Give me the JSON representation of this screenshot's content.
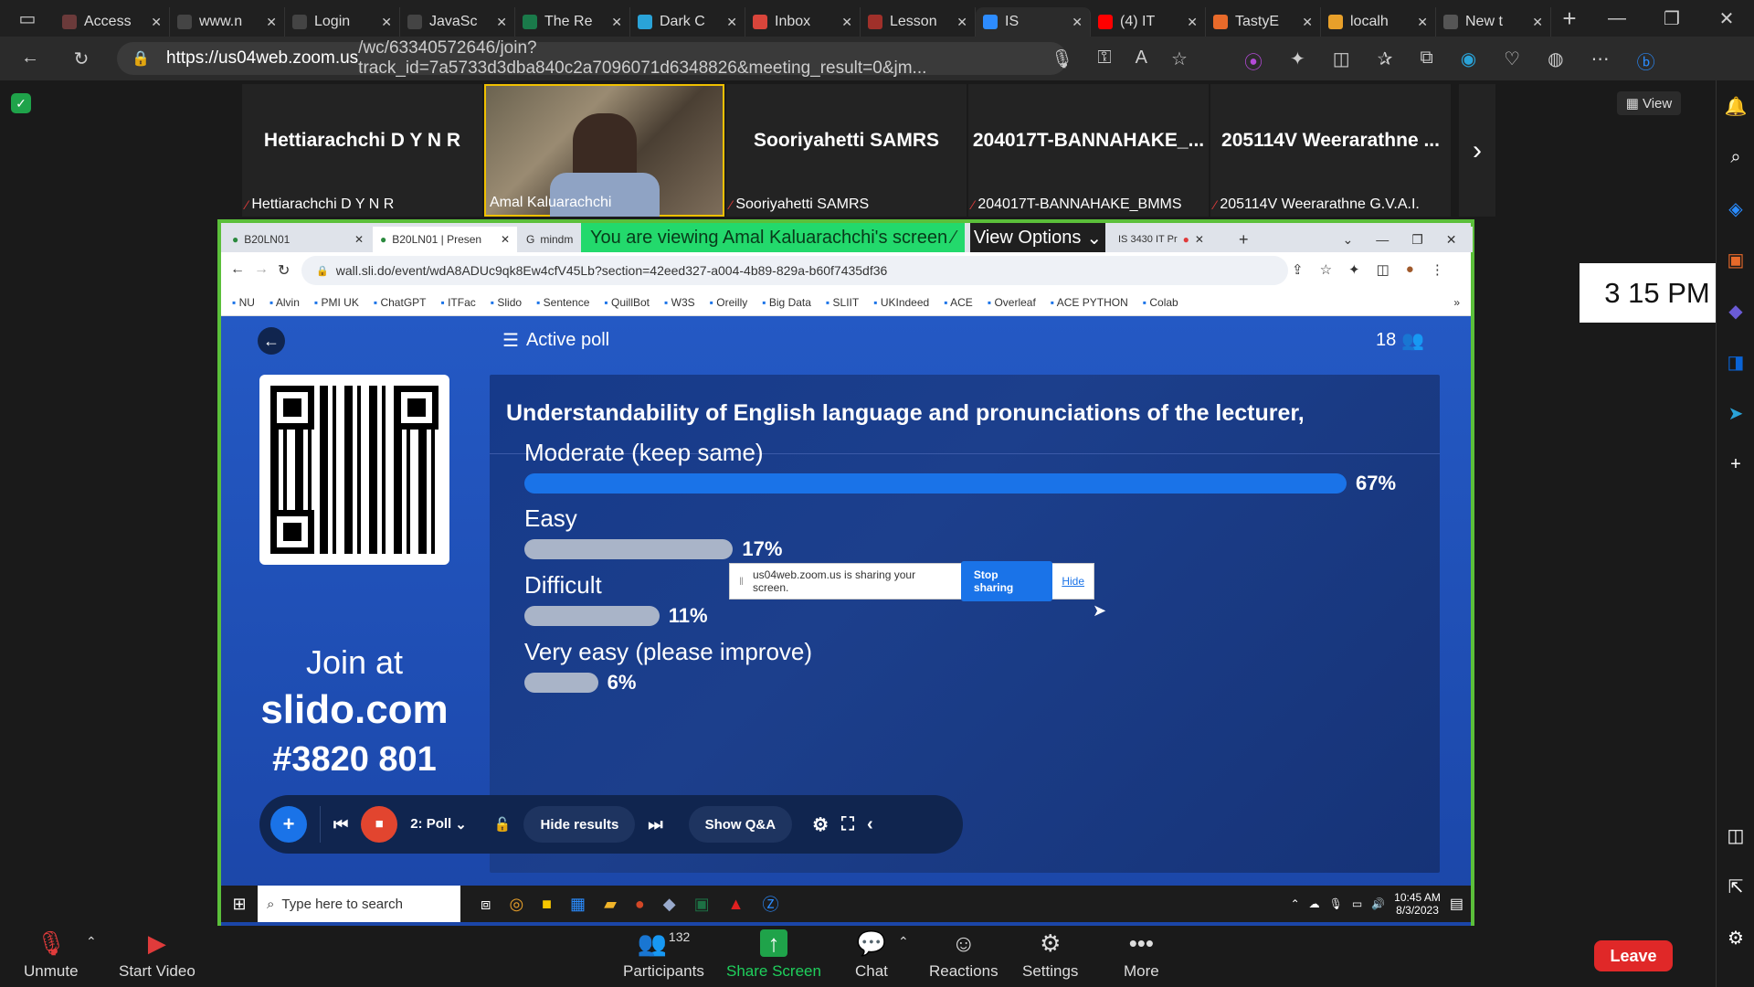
{
  "browser": {
    "tabs": [
      {
        "title": "Access",
        "color": "#6b3a3a"
      },
      {
        "title": "www.n",
        "color": "#444"
      },
      {
        "title": "Login",
        "color": "#444"
      },
      {
        "title": "JavaSc",
        "color": "#444"
      },
      {
        "title": "The Re",
        "color": "#1a7a4a"
      },
      {
        "title": "Dark C",
        "color": "#2aa3d8"
      },
      {
        "title": "Inbox",
        "color": "#d9453b"
      },
      {
        "title": "Lesson",
        "color": "#a0302a"
      },
      {
        "title": "IS",
        "color": "#2d8cff"
      },
      {
        "title": "(4) IT",
        "color": "#ff0000"
      },
      {
        "title": "TastyE",
        "color": "#e86a2a"
      },
      {
        "title": "localh",
        "color": "#e8a02a"
      },
      {
        "title": "New t",
        "color": "#555"
      }
    ],
    "url_host": "https://us04web.zoom.us",
    "url_path": "/wc/63340572646/join?track_id=7a5733d3dba840c2a7096071d6348826&meeting_result=0&jm..."
  },
  "participants": [
    {
      "name": "Hettiarachchi D Y N R",
      "label": "Hettiarachchi D Y N R",
      "video": false,
      "muted": true
    },
    {
      "name": "",
      "label": "Amal Kaluarachchi",
      "video": true,
      "muted": false
    },
    {
      "name": "Sooriyahetti SAMRS",
      "label": "Sooriyahetti SAMRS",
      "video": false,
      "muted": true
    },
    {
      "name": "204017T-BANNAHAKE_...",
      "label": "204017T-BANNAHAKE_BMMS",
      "video": false,
      "muted": true
    },
    {
      "name": "205114V Weerarathne ...",
      "label": "205114V Weerarathne G.V.A.I.",
      "video": false,
      "muted": true
    }
  ],
  "view_button": "View",
  "clock_text": "3 15 PM",
  "share": {
    "banner": "You are viewing Amal Kaluarachchi's screen",
    "view_options": "View Options",
    "chrome_tabs": [
      "B20LN01",
      "B20LN01 | Presen",
      "mindm",
      "IS 3430 IT Pr"
    ],
    "chrome_url": "wall.sli.do/event/wdA8ADUc9qk8Ew4cfV45Lb?section=42eed327-a004-4b89-829a-b60f7435df36",
    "bookmarks": [
      "NU",
      "Alvin",
      "PMI UK",
      "ChatGPT",
      "ITFac",
      "Slido",
      "Sentence",
      "QuillBot",
      "W3S",
      "Oreilly",
      "Big Data",
      "SLIIT",
      "UKIndeed",
      "ACE",
      "Overleaf",
      "ACE PYTHON",
      "Colab"
    ],
    "notice_text": "us04web.zoom.us is sharing your screen.",
    "notice_stop": "Stop sharing",
    "notice_hide": "Hide"
  },
  "slido": {
    "header": "Active poll",
    "participant_count": "18",
    "join_at": "Join at",
    "site": "slido.com",
    "code": "#3820 801",
    "question": "Understandability of English language and pronunciations of the lecturer,",
    "options": [
      {
        "label": "Moderate (keep same)",
        "percent": 67,
        "percent_text": "67%",
        "color": "#1a73e8"
      },
      {
        "label": "Easy",
        "percent": 17,
        "percent_text": "17%",
        "color": "#a9b4c8"
      },
      {
        "label": "Difficult",
        "percent": 11,
        "percent_text": "11%",
        "color": "#a9b4c8"
      },
      {
        "label": "Very easy (please improve)",
        "percent": 6,
        "percent_text": "6%",
        "color": "#a9b4c8"
      }
    ],
    "toolbar": {
      "poll_label": "2: Poll",
      "hide_results": "Hide results",
      "show_qa": "Show Q&A"
    }
  },
  "windows_taskbar": {
    "search_placeholder": "Type here to search",
    "time": "10:45 AM",
    "date": "8/3/2023"
  },
  "zoom_bar": {
    "unmute": "Unmute",
    "start_video": "Start Video",
    "participants": "Participants",
    "participants_count": "132",
    "share_screen": "Share Screen",
    "chat": "Chat",
    "reactions": "Reactions",
    "settings": "Settings",
    "more": "More",
    "leave": "Leave"
  }
}
